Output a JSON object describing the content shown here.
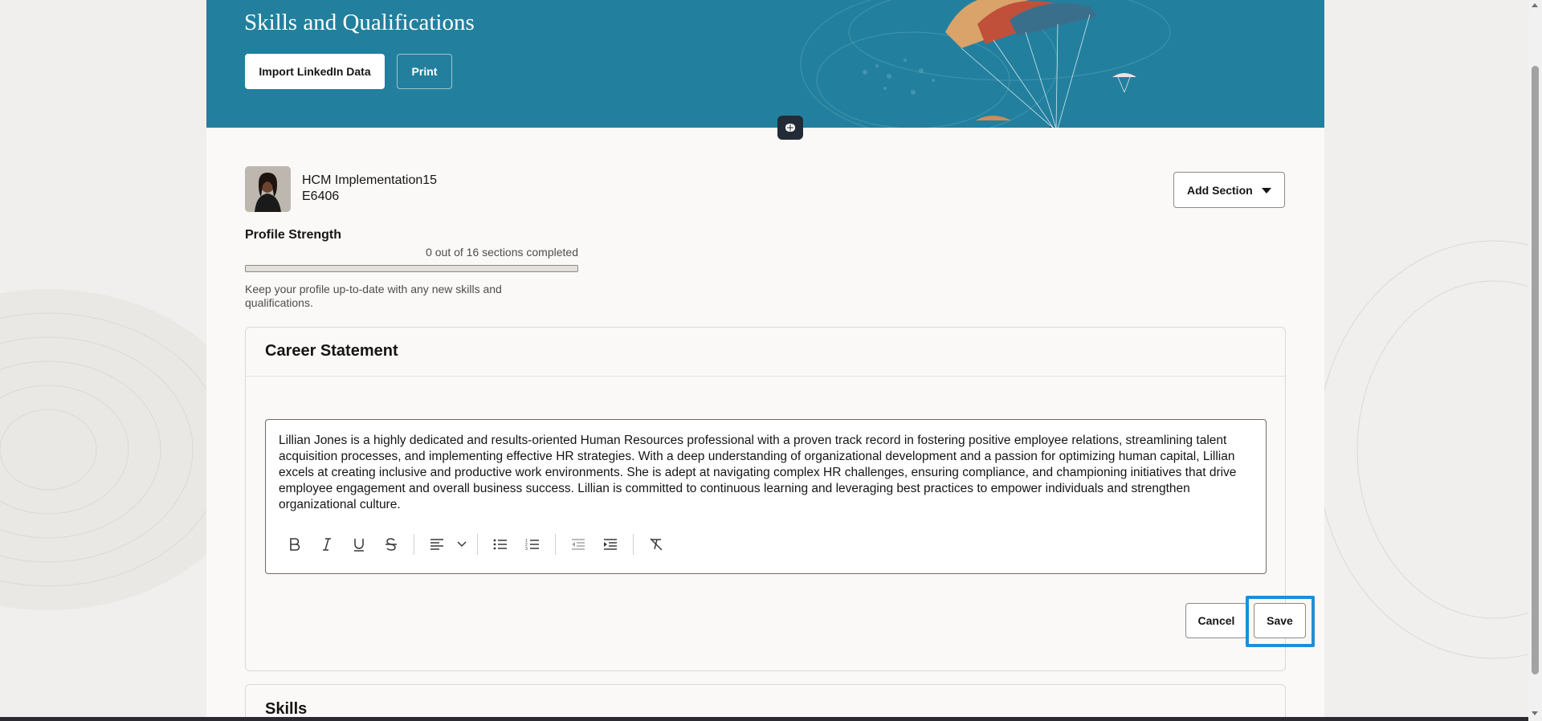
{
  "hero": {
    "title": "Skills and Qualifications",
    "import_label": "Import LinkedIn Data",
    "print_label": "Print"
  },
  "person": {
    "name": "HCM Implementation15",
    "id": "E6406"
  },
  "add_section_label": "Add Section",
  "profile_strength": {
    "label": "Profile Strength",
    "count_text": "0 out of 16 sections completed",
    "progress_fraction": 0,
    "hint": "Keep your profile up-to-date with any new skills and qualifications."
  },
  "career_statement": {
    "title": "Career Statement",
    "text": "Lillian Jones is a highly dedicated and results-oriented Human Resources professional with a proven track record in fostering positive employee relations, streamlining talent acquisition processes, and implementing effective HR strategies. With a deep understanding of organizational development and a passion for optimizing human capital, Lillian excels at creating inclusive and productive work environments. She is adept at navigating complex HR challenges, ensuring compliance, and championing initiatives that drive employee engagement and overall business success. Lillian is committed to continuous learning and leveraging best practices to empower individuals and strengthen organizational culture.",
    "toolbar_icons": [
      "bold-icon",
      "italic-icon",
      "underline-icon",
      "strikethrough-icon",
      "align-left-icon",
      "chevron-down-icon",
      "bullet-list-icon",
      "numbered-list-icon",
      "outdent-icon",
      "indent-icon",
      "clear-formatting-icon"
    ],
    "cancel_label": "Cancel",
    "save_label": "Save"
  },
  "skills": {
    "title": "Skills"
  },
  "colors": {
    "hero_bg": "#22809e",
    "focus_ring": "#1d8ed9",
    "page_bg": "#f1efed"
  }
}
